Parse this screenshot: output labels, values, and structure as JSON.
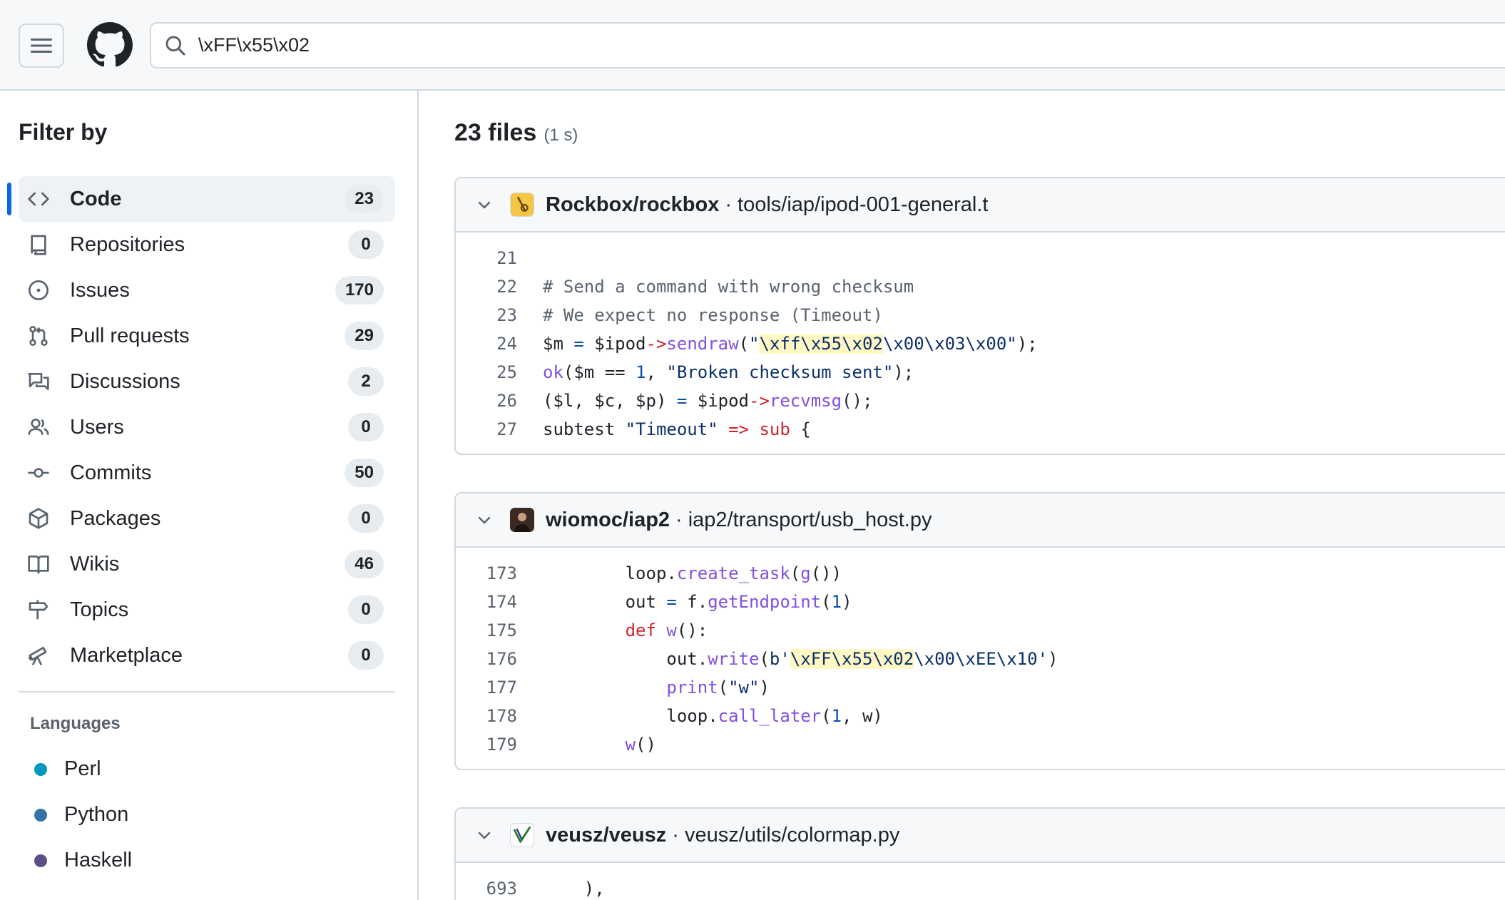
{
  "header": {
    "search_query": "\\xFF\\x55\\x02"
  },
  "sidebar": {
    "title": "Filter by",
    "items": [
      {
        "label": "Code",
        "count": "23",
        "icon": "code-icon"
      },
      {
        "label": "Repositories",
        "count": "0",
        "icon": "repo-icon"
      },
      {
        "label": "Issues",
        "count": "170",
        "icon": "issue-icon"
      },
      {
        "label": "Pull requests",
        "count": "29",
        "icon": "pull-request-icon"
      },
      {
        "label": "Discussions",
        "count": "2",
        "icon": "discussion-icon"
      },
      {
        "label": "Users",
        "count": "0",
        "icon": "people-icon"
      },
      {
        "label": "Commits",
        "count": "50",
        "icon": "commit-icon"
      },
      {
        "label": "Packages",
        "count": "0",
        "icon": "package-icon"
      },
      {
        "label": "Wikis",
        "count": "46",
        "icon": "book-icon"
      },
      {
        "label": "Topics",
        "count": "0",
        "icon": "signpost-icon"
      },
      {
        "label": "Marketplace",
        "count": "0",
        "icon": "telescope-icon"
      }
    ],
    "languages_title": "Languages",
    "languages": [
      {
        "name": "Perl",
        "color": "#0298c3"
      },
      {
        "name": "Python",
        "color": "#3572A5"
      },
      {
        "name": "Haskell",
        "color": "#5e5086"
      }
    ]
  },
  "main": {
    "results_count": "23 files",
    "results_time": "(1 s)",
    "results": [
      {
        "repo": "Rockbox/rockbox",
        "path": "tools/iap/ipod-001-general.t",
        "line_numbers": [
          "21",
          "22",
          "23",
          "24",
          "25",
          "26",
          "27"
        ],
        "lines": [
          "",
          "# Send a command with wrong checksum",
          "# We expect no response (Timeout)",
          "$m = $ipod->sendraw(\"\\xff\\x55\\x02\\x00\\x03\\x00\");",
          "ok($m == 1, \"Broken checksum sent\");",
          "($l, $c, $p) = $ipod->recvmsg();",
          "subtest \"Timeout\" => sub {"
        ]
      },
      {
        "repo": "wiomoc/iap2",
        "path": "iap2/transport/usb_host.py",
        "line_numbers": [
          "173",
          "174",
          "175",
          "176",
          "177",
          "178",
          "179"
        ],
        "lines": [
          "        loop.create_task(g())",
          "        out = f.getEndpoint(1)",
          "        def w():",
          "            out.write(b'\\xFF\\x55\\x02\\x00\\xEE\\x10')",
          "            print(\"w\")",
          "            loop.call_later(1, w)",
          "        w()"
        ]
      },
      {
        "repo": "veusz/veusz",
        "path": "veusz/utils/colormap.py",
        "line_numbers": [
          "693"
        ],
        "lines": [
          "    ),"
        ]
      }
    ]
  }
}
